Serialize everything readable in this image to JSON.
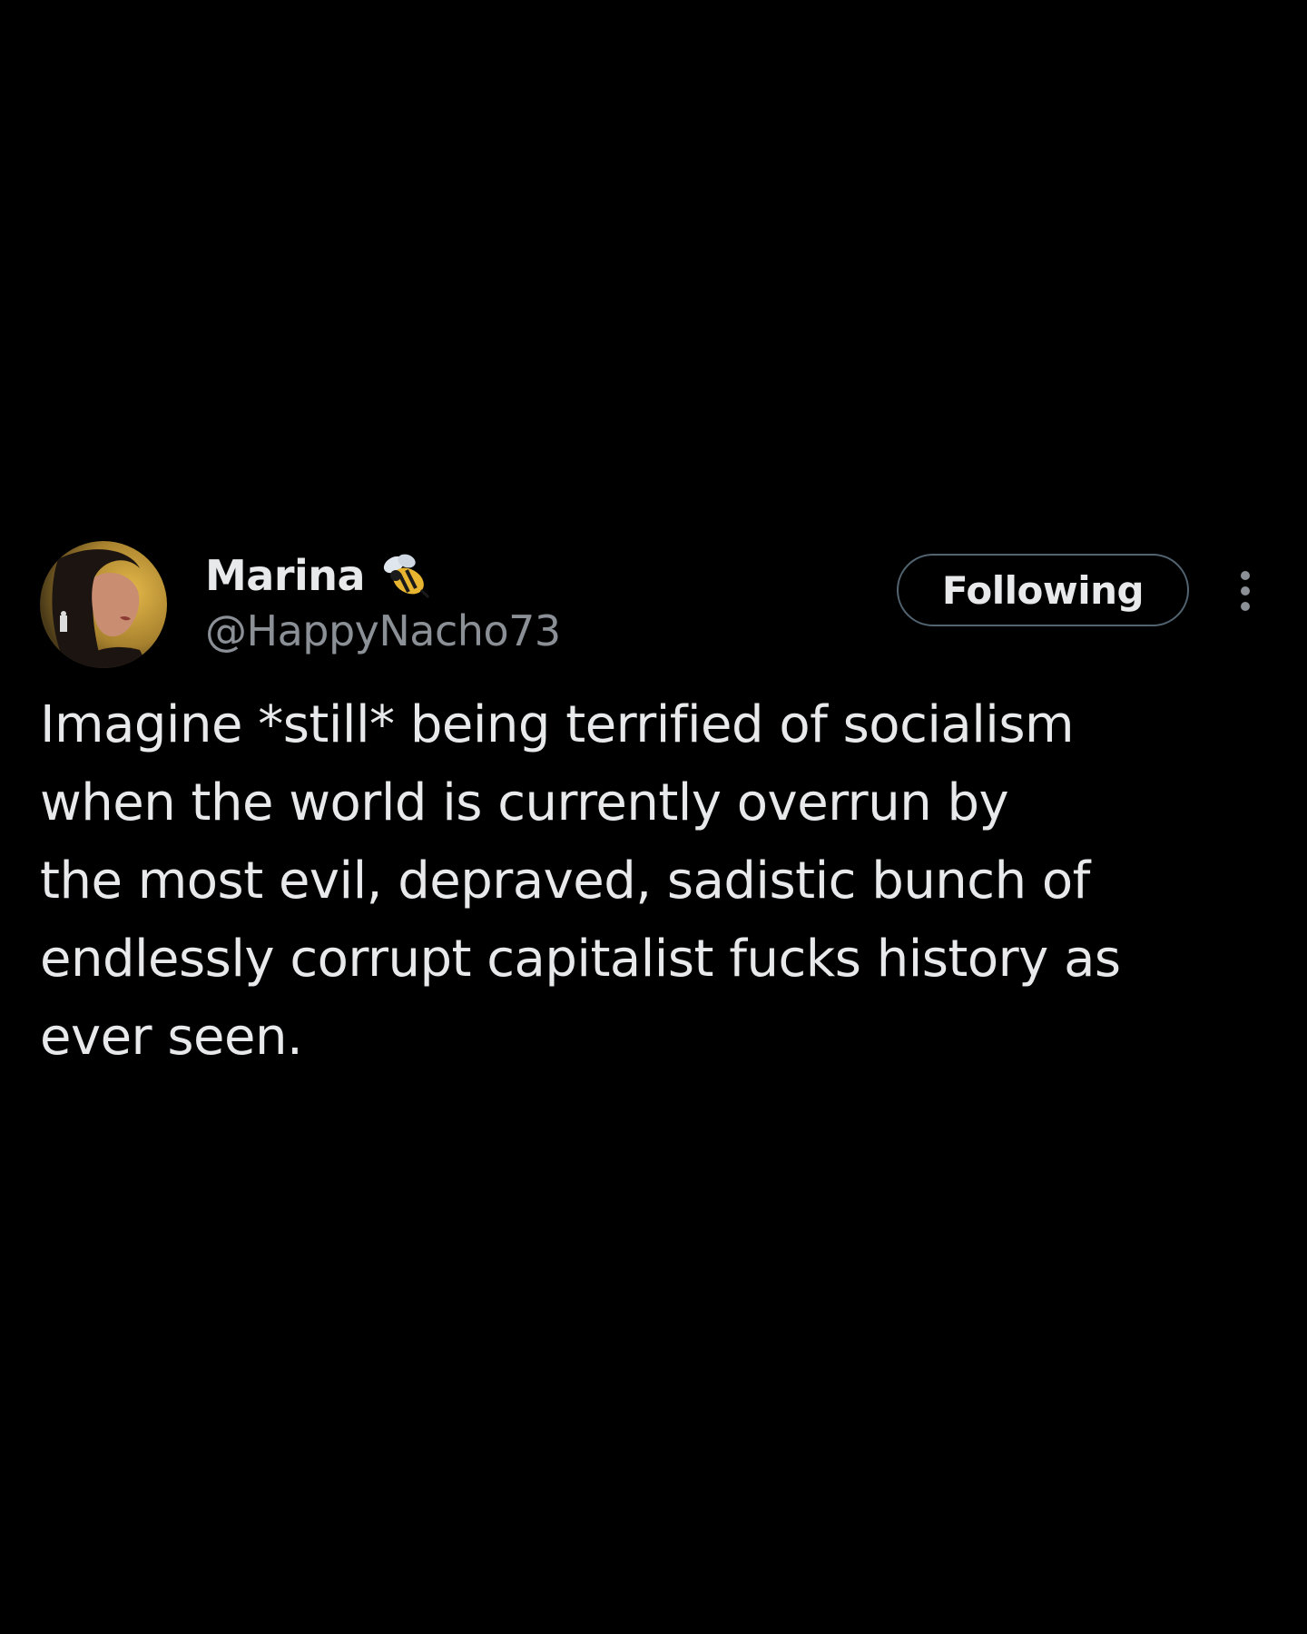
{
  "author": {
    "display_name": "Marina",
    "handle": "@HappyNacho73",
    "avatar_icon": "profile-photo",
    "badge_icon": "bee-icon"
  },
  "follow_button": {
    "label": "Following"
  },
  "more_icon": "more-options-vertical-dots",
  "tweet": {
    "lines": [
      "Imagine *still* being terrified of socialism",
      "when the world is currently overrun by",
      "the most evil, depraved, sadistic bunch of",
      "endlessly corrupt capitalist fucks history as",
      "ever seen."
    ]
  },
  "colors": {
    "background": "#000000",
    "primary_text": "#e7e9ea",
    "secondary_text": "#8b9096",
    "button_border": "#536471"
  }
}
